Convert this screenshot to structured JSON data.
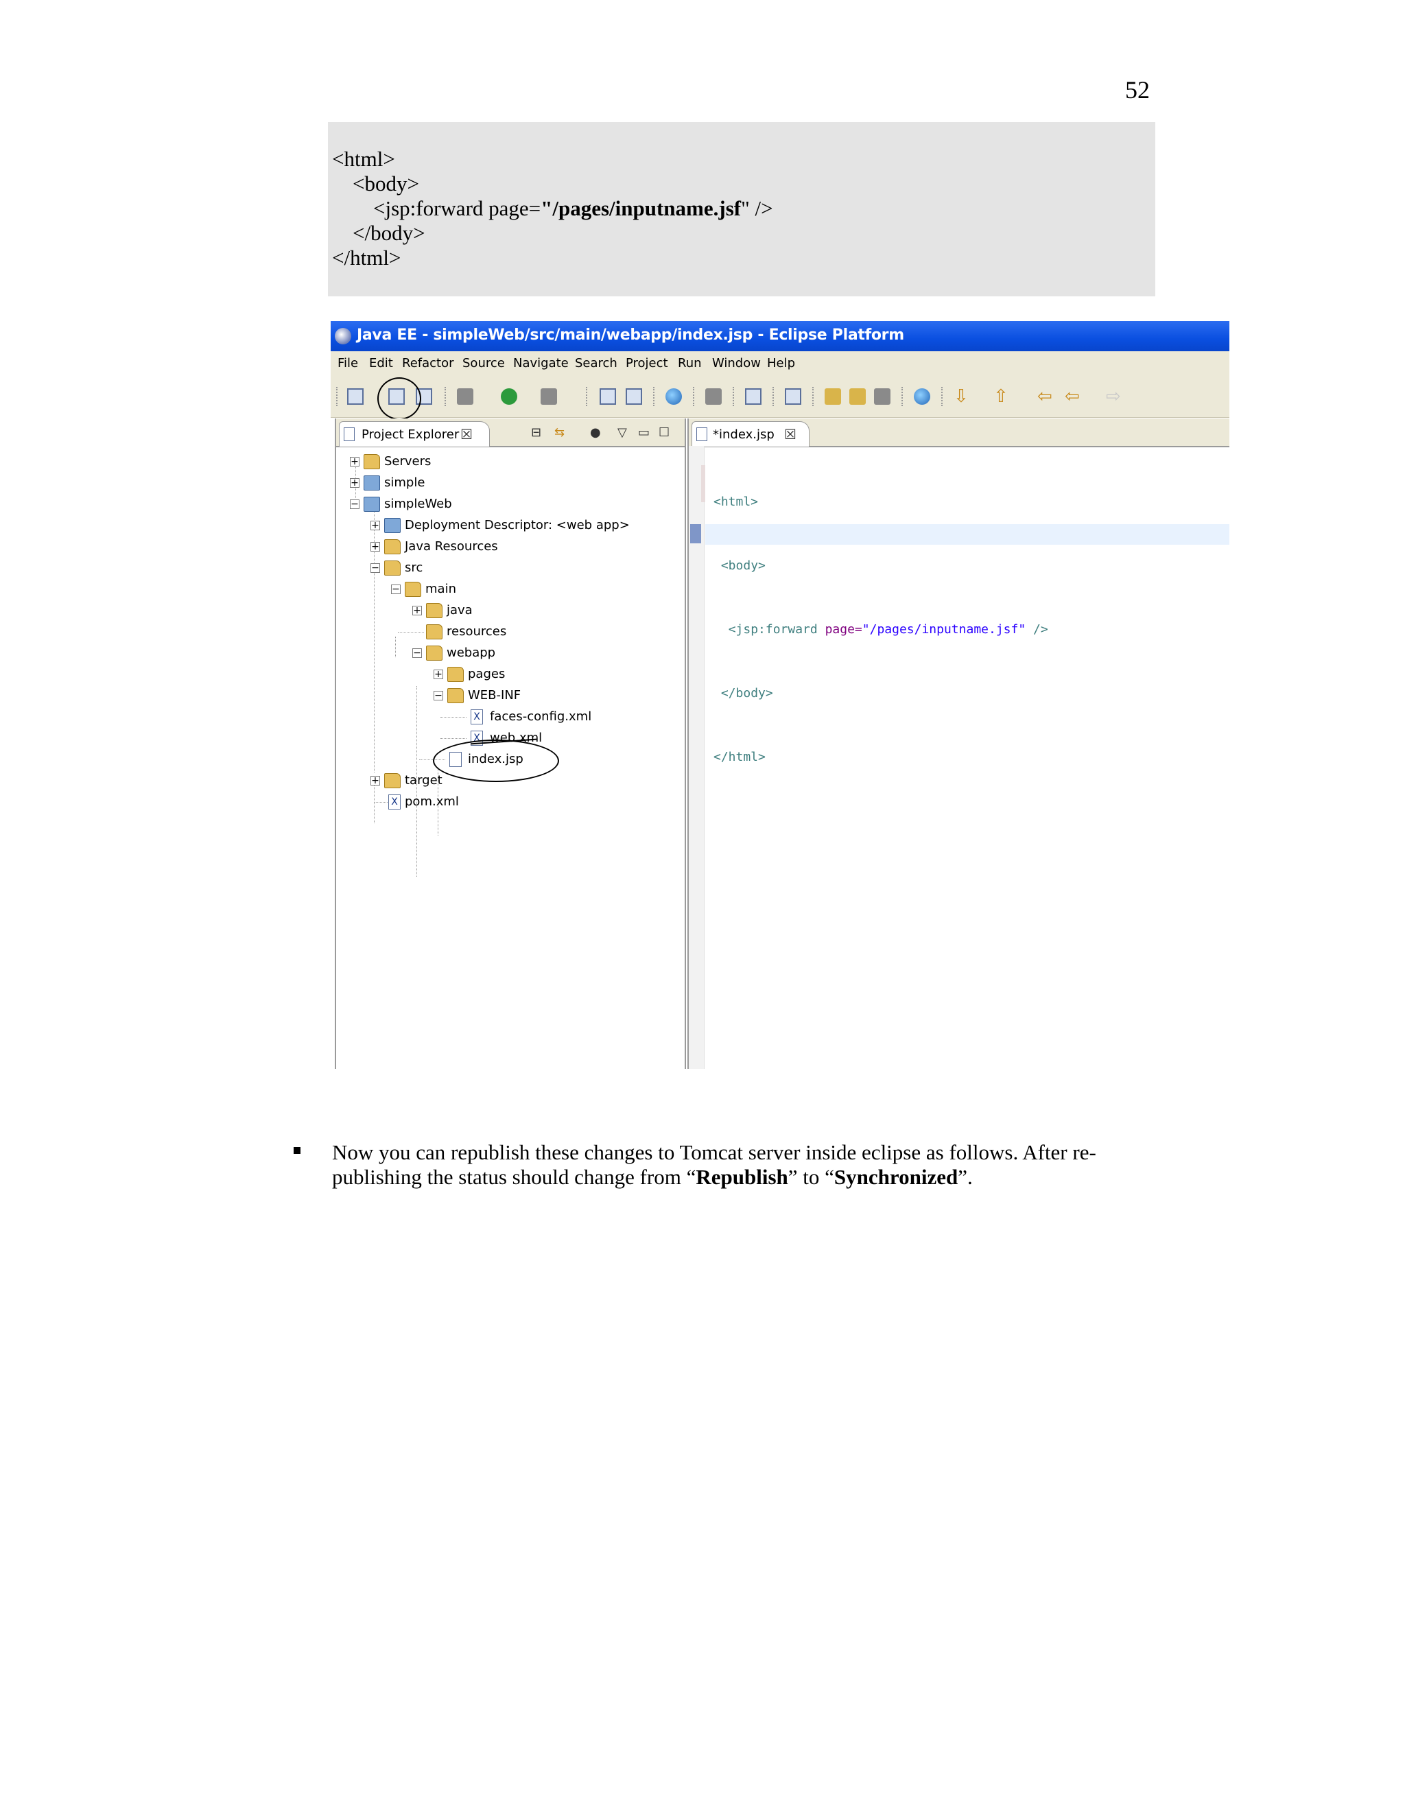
{
  "page_number": "52",
  "code_listing": {
    "line1": "<html>",
    "line2": "<body>",
    "line3_prefix": "<jsp:forward page=",
    "line3_bold": "\"/pages/inputname.jsf",
    "line3_suffix": "\" />",
    "line4": "</body>",
    "line5": "</html>"
  },
  "screenshot": {
    "window_title": "Java EE - simpleWeb/src/main/webapp/index.jsp - Eclipse Platform",
    "menu": [
      "File",
      "Edit",
      "Refactor",
      "Source",
      "Navigate",
      "Search",
      "Project",
      "Run",
      "Window",
      "Help"
    ],
    "left_view": {
      "tab_label": "Project Explorer",
      "tab_close": "☒",
      "tree": [
        {
          "label": "Servers",
          "depth": 0,
          "expander": "+",
          "icon": "folder-icon"
        },
        {
          "label": "simple",
          "depth": 0,
          "expander": "+",
          "icon": "project-icon"
        },
        {
          "label": "simpleWeb",
          "depth": 0,
          "expander": "-",
          "icon": "project-icon"
        },
        {
          "label": "Deployment Descriptor: <web app>",
          "depth": 1,
          "expander": "+",
          "icon": "descriptor-icon"
        },
        {
          "label": "Java Resources",
          "depth": 1,
          "expander": "+",
          "icon": "library-icon"
        },
        {
          "label": "src",
          "depth": 1,
          "expander": "-",
          "icon": "folder-icon"
        },
        {
          "label": "main",
          "depth": 2,
          "expander": "-",
          "icon": "folder-icon"
        },
        {
          "label": "java",
          "depth": 3,
          "expander": "+",
          "icon": "folder-icon"
        },
        {
          "label": "resources",
          "depth": 3,
          "expander": "",
          "icon": "folder-icon"
        },
        {
          "label": "webapp",
          "depth": 3,
          "expander": "-",
          "icon": "folder-icon"
        },
        {
          "label": "pages",
          "depth": 4,
          "expander": "+",
          "icon": "folder-icon"
        },
        {
          "label": "WEB-INF",
          "depth": 4,
          "expander": "-",
          "icon": "folder-icon"
        },
        {
          "label": "faces-config.xml",
          "depth": 5,
          "expander": "",
          "icon": "xml-file-icon"
        },
        {
          "label": "web.xml",
          "depth": 5,
          "expander": "",
          "icon": "xml-file-icon"
        },
        {
          "label": "index.jsp",
          "depth": 4,
          "expander": "",
          "icon": "jsp-file-icon"
        },
        {
          "label": "target",
          "depth": 1,
          "expander": "+",
          "icon": "folder-icon"
        },
        {
          "label": "pom.xml",
          "depth": 1,
          "expander": "",
          "icon": "xml-file-icon"
        }
      ]
    },
    "editor": {
      "tab_label": "*index.jsp",
      "tab_close": "☒",
      "line1_tag": "<html>",
      "line2_tag": "<body>",
      "line3_tag": "<jsp:forward",
      "line3_attr": "page=",
      "line3_val": "\"/pages/inputname.jsf\"",
      "line3_end": "/>",
      "line4_tag": "</body>",
      "line5_tag": "</html>"
    }
  },
  "bullet_paragraph": {
    "text_a": "Now you can republish these changes to Tomcat server inside eclipse as follows. After re-publishing the status should change from “",
    "bold_a": "Republish",
    "text_b": "” to “",
    "bold_b": "Synchronized",
    "text_c": "”."
  }
}
